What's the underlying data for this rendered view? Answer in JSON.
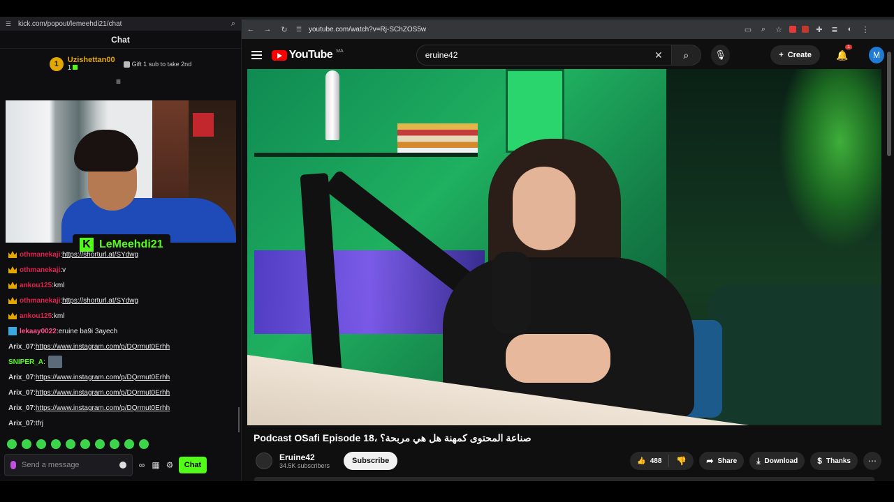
{
  "kick": {
    "url": "kick.com/popout/lemeehdi21/chat",
    "title": "Chat",
    "pinned": {
      "badge": "1",
      "username": "Uzishettan00",
      "count": "1",
      "gift_text": "Gift 1 sub to take 2nd"
    },
    "stream_label": "LeMeehdi21",
    "messages": [
      {
        "badge": "crown",
        "user": "othmanekaji",
        "user_color": "red",
        "text": "https://shorturl.at/SYdwg",
        "link": true
      },
      {
        "badge": "crown",
        "user": "othmanekaji",
        "user_color": "red",
        "text": "v",
        "link": false
      },
      {
        "badge": "crown",
        "user": "ankou125",
        "user_color": "red",
        "text": "kml",
        "link": false
      },
      {
        "badge": "crown",
        "user": "othmanekaji",
        "user_color": "red",
        "text": "https://shorturl.at/SYdwg",
        "link": true
      },
      {
        "badge": "crown",
        "user": "ankou125",
        "user_color": "red",
        "text": "kml",
        "link": false
      },
      {
        "badge": "bolt",
        "user": "lekaay0022",
        "user_color": "pink",
        "text": "eruine ba9i 3ayech",
        "link": false
      },
      {
        "badge": "",
        "user": "Arix_07",
        "user_color": "gray",
        "text": "https://www.instagram.com/p/DQrmut0Erhh",
        "link": true
      },
      {
        "badge": "",
        "user": "SNIPER_A",
        "user_color": "green",
        "text": "",
        "link": false,
        "emote": true
      },
      {
        "badge": "",
        "user": "Arix_07",
        "user_color": "gray",
        "text": "https://www.instagram.com/p/DQrmut0Erhh",
        "link": true
      },
      {
        "badge": "",
        "user": "Arix_07",
        "user_color": "gray",
        "text": "https://www.instagram.com/p/DQrmut0Erhh",
        "link": true
      },
      {
        "badge": "",
        "user": "Arix_07",
        "user_color": "gray",
        "text": "https://www.instagram.com/p/DQrmut0Erhh",
        "link": true
      },
      {
        "badge": "",
        "user": "Arix_07",
        "user_color": "gray",
        "text": "tfrj",
        "link": false
      }
    ],
    "emote_count": 10,
    "input_placeholder": "Send a message",
    "chat_button": "Chat",
    "accent": "#53fc18"
  },
  "browser": {
    "url": "youtube.com/watch?v=Rj-SChZOS5w"
  },
  "youtube": {
    "logo_text": "YouTube",
    "country": "MA",
    "search_query": "eruine42",
    "create_label": "Create",
    "notification_count": "1",
    "avatar_letter": "M",
    "video_title": "Podcast OSafi Episode 18، صناعة المحتوى كمهنة هل هي مربحة؟",
    "channel_name": "Eruine42",
    "subscribers": "34.5K subscribers",
    "subscribe_label": "Subscribe",
    "likes": "488",
    "share_label": "Share",
    "download_label": "Download",
    "thanks_label": "Thanks",
    "brand_color": "#ff0000"
  }
}
